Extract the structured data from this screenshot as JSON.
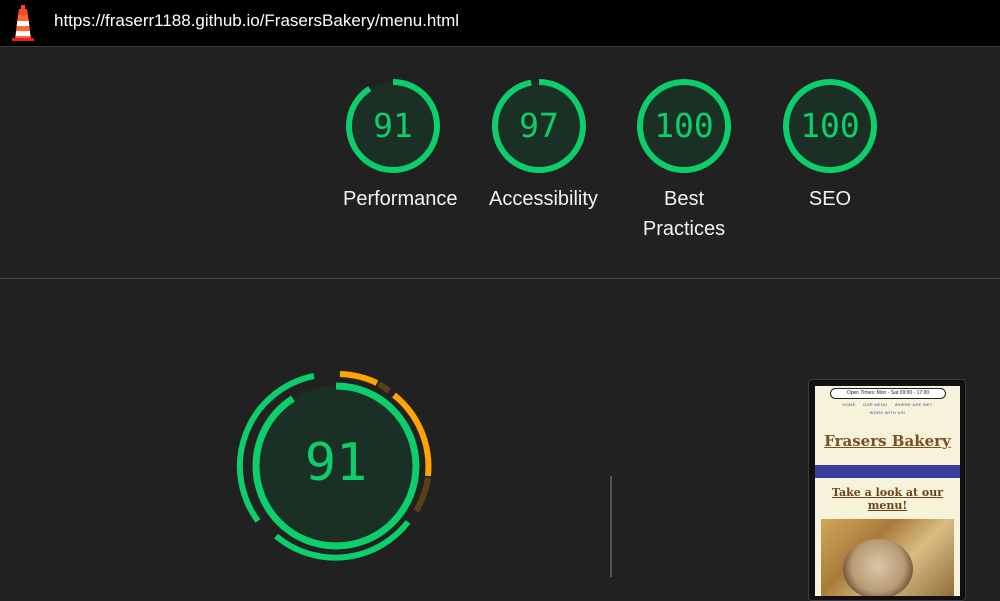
{
  "browser": {
    "url": "https://fraserr1188.github.io/FrasersBakery/menu.html",
    "icon": "lighthouse-icon"
  },
  "scores": [
    {
      "label": "Performance",
      "value": "91",
      "fraction": 0.91
    },
    {
      "label": "Accessibility",
      "value": "97",
      "fraction": 0.97
    },
    {
      "label": "Best Practices",
      "value": "100",
      "fraction": 1.0
    },
    {
      "label": "SEO",
      "value": "100",
      "fraction": 1.0
    }
  ],
  "performance_detail": {
    "value": "91",
    "fraction": 0.91
  },
  "colors": {
    "pass": "#0cce6b",
    "pass_bg": "#1b3024",
    "average": "#ffa400",
    "background": "#212121"
  },
  "preview": {
    "open_times": "Open Times: Mon - Sat 09:00 - 17:00",
    "nav_row1": [
      "HOME",
      "OUR MENU",
      "WHERE ARE WE?"
    ],
    "nav_row2": [
      "WORK WITH US!"
    ],
    "brand": "Frasers Bakery",
    "menu_heading": "Take a look at our menu!"
  }
}
